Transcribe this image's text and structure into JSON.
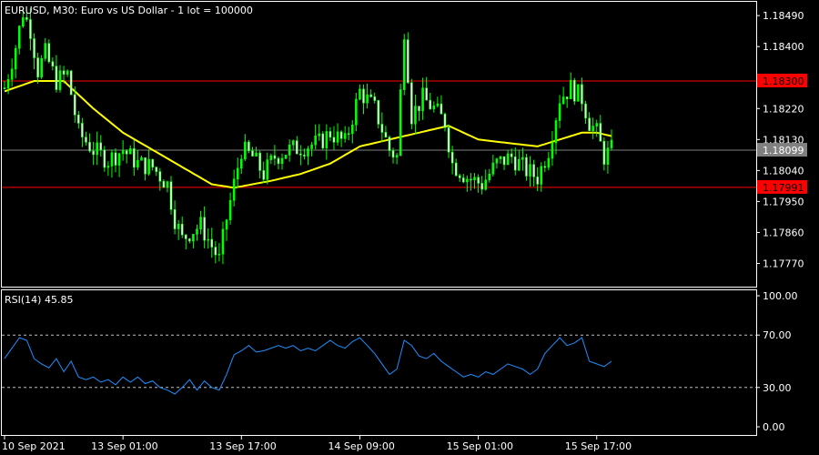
{
  "colors": {
    "background": "#000000",
    "axis": "#ffffff",
    "bull": "#00ff00",
    "bear": "#ffffff",
    "ma": "#ffff00",
    "level": "#ff0000",
    "current": "#808080",
    "rsi": "#1e90ff",
    "rsi_levels": "#c0c0c0"
  },
  "chart_data": [
    {
      "type": "candlestick",
      "title": "EURUSD, M30:  Euro vs US Dollar - 1 lot = 100000",
      "ylim": [
        1.177,
        1.1853
      ],
      "y_ticks": [
        "1.18490",
        "1.18400",
        "1.18310",
        "1.18220",
        "1.18130",
        "1.18040",
        "1.17950",
        "1.17860",
        "1.17770"
      ],
      "y_tick_values": [
        1.1849,
        1.184,
        1.1831,
        1.1822,
        1.1813,
        1.1804,
        1.1795,
        1.1786,
        1.1777
      ],
      "x_ticks": [
        "10 Sep 2021",
        "13 Sep 01:00",
        "13 Sep 17:00",
        "14 Sep 09:00",
        "15 Sep 01:00",
        "15 Sep 17:00"
      ],
      "x_tick_index": [
        0,
        32,
        64,
        96,
        128,
        160
      ],
      "levels": [
        {
          "label": "1.18300",
          "value": 1.183
        },
        {
          "label": "1.17991",
          "value": 1.17991
        }
      ],
      "current": {
        "label": "1.18099",
        "value": 1.18099
      },
      "bars": 165,
      "close_path": [
        [
          0,
          1.1828
        ],
        [
          3,
          1.184
        ],
        [
          5,
          1.185
        ],
        [
          7,
          1.1845
        ],
        [
          9,
          1.1833
        ],
        [
          11,
          1.1838
        ],
        [
          14,
          1.183
        ],
        [
          17,
          1.1832
        ],
        [
          20,
          1.1815
        ],
        [
          24,
          1.181
        ],
        [
          28,
          1.1807
        ],
        [
          32,
          1.181
        ],
        [
          36,
          1.1806
        ],
        [
          40,
          1.1805
        ],
        [
          44,
          1.18
        ],
        [
          46,
          1.179
        ],
        [
          48,
          1.1784
        ],
        [
          50,
          1.1786
        ],
        [
          53,
          1.1788
        ],
        [
          56,
          1.1782
        ],
        [
          58,
          1.1778
        ],
        [
          60,
          1.179
        ],
        [
          62,
          1.18
        ],
        [
          64,
          1.181
        ],
        [
          67,
          1.1808
        ],
        [
          70,
          1.1803
        ],
        [
          73,
          1.1808
        ],
        [
          77,
          1.181
        ],
        [
          81,
          1.1811
        ],
        [
          85,
          1.1812
        ],
        [
          88,
          1.1815
        ],
        [
          92,
          1.1812
        ],
        [
          96,
          1.1827
        ],
        [
          100,
          1.1822
        ],
        [
          104,
          1.181
        ],
        [
          106,
          1.1808
        ],
        [
          108,
          1.1845
        ],
        [
          110,
          1.182
        ],
        [
          113,
          1.1825
        ],
        [
          116,
          1.1822
        ],
        [
          119,
          1.1818
        ],
        [
          121,
          1.1806
        ],
        [
          125,
          1.1802
        ],
        [
          129,
          1.18
        ],
        [
          133,
          1.1806
        ],
        [
          137,
          1.1808
        ],
        [
          141,
          1.1804
        ],
        [
          144,
          1.1802
        ],
        [
          147,
          1.181
        ],
        [
          150,
          1.1825
        ],
        [
          153,
          1.1828
        ],
        [
          156,
          1.1825
        ],
        [
          158,
          1.1818
        ],
        [
          160,
          1.1815
        ],
        [
          162,
          1.1808
        ],
        [
          164,
          1.181
        ]
      ],
      "ma_path": [
        [
          0,
          1.1827
        ],
        [
          8,
          1.183
        ],
        [
          16,
          1.183
        ],
        [
          24,
          1.1822
        ],
        [
          32,
          1.1815
        ],
        [
          40,
          1.181
        ],
        [
          48,
          1.1805
        ],
        [
          56,
          1.18
        ],
        [
          62,
          1.1799
        ],
        [
          72,
          1.1801
        ],
        [
          80,
          1.1803
        ],
        [
          88,
          1.1806
        ],
        [
          96,
          1.1811
        ],
        [
          104,
          1.1813
        ],
        [
          112,
          1.1815
        ],
        [
          120,
          1.1817
        ],
        [
          128,
          1.1813
        ],
        [
          136,
          1.1812
        ],
        [
          144,
          1.1811
        ],
        [
          150,
          1.1813
        ],
        [
          156,
          1.1815
        ],
        [
          160,
          1.1815
        ],
        [
          164,
          1.1814
        ]
      ]
    },
    {
      "type": "line",
      "title": "RSI(14) 45.85",
      "ylim": [
        0,
        100
      ],
      "y_ticks": [
        "100.00",
        "70.00",
        "30.00",
        "0.00"
      ],
      "y_tick_values": [
        100,
        70,
        30,
        0
      ],
      "levels": [
        70,
        30
      ],
      "points": [
        [
          0,
          52
        ],
        [
          2,
          60
        ],
        [
          4,
          68
        ],
        [
          6,
          66
        ],
        [
          8,
          52
        ],
        [
          10,
          48
        ],
        [
          12,
          45
        ],
        [
          14,
          52
        ],
        [
          16,
          42
        ],
        [
          18,
          50
        ],
        [
          20,
          38
        ],
        [
          22,
          36
        ],
        [
          24,
          38
        ],
        [
          26,
          34
        ],
        [
          28,
          36
        ],
        [
          30,
          32
        ],
        [
          32,
          38
        ],
        [
          34,
          34
        ],
        [
          36,
          38
        ],
        [
          38,
          33
        ],
        [
          40,
          35
        ],
        [
          42,
          30
        ],
        [
          44,
          28
        ],
        [
          46,
          25
        ],
        [
          48,
          30
        ],
        [
          50,
          36
        ],
        [
          52,
          28
        ],
        [
          54,
          35
        ],
        [
          56,
          30
        ],
        [
          58,
          28
        ],
        [
          60,
          40
        ],
        [
          62,
          55
        ],
        [
          64,
          58
        ],
        [
          66,
          62
        ],
        [
          68,
          57
        ],
        [
          70,
          58
        ],
        [
          72,
          60
        ],
        [
          74,
          62
        ],
        [
          76,
          60
        ],
        [
          78,
          62
        ],
        [
          80,
          58
        ],
        [
          82,
          60
        ],
        [
          84,
          58
        ],
        [
          86,
          62
        ],
        [
          88,
          66
        ],
        [
          90,
          62
        ],
        [
          92,
          60
        ],
        [
          94,
          65
        ],
        [
          96,
          68
        ],
        [
          98,
          62
        ],
        [
          100,
          56
        ],
        [
          102,
          48
        ],
        [
          104,
          40
        ],
        [
          106,
          44
        ],
        [
          108,
          66
        ],
        [
          110,
          62
        ],
        [
          112,
          54
        ],
        [
          114,
          52
        ],
        [
          116,
          56
        ],
        [
          118,
          50
        ],
        [
          120,
          46
        ],
        [
          122,
          42
        ],
        [
          124,
          38
        ],
        [
          126,
          40
        ],
        [
          128,
          38
        ],
        [
          130,
          42
        ],
        [
          132,
          40
        ],
        [
          134,
          44
        ],
        [
          136,
          48
        ],
        [
          138,
          46
        ],
        [
          140,
          44
        ],
        [
          142,
          40
        ],
        [
          144,
          44
        ],
        [
          146,
          56
        ],
        [
          148,
          62
        ],
        [
          150,
          68
        ],
        [
          152,
          62
        ],
        [
          154,
          64
        ],
        [
          156,
          68
        ],
        [
          158,
          50
        ],
        [
          160,
          48
        ],
        [
          162,
          46
        ],
        [
          164,
          50
        ]
      ]
    }
  ]
}
